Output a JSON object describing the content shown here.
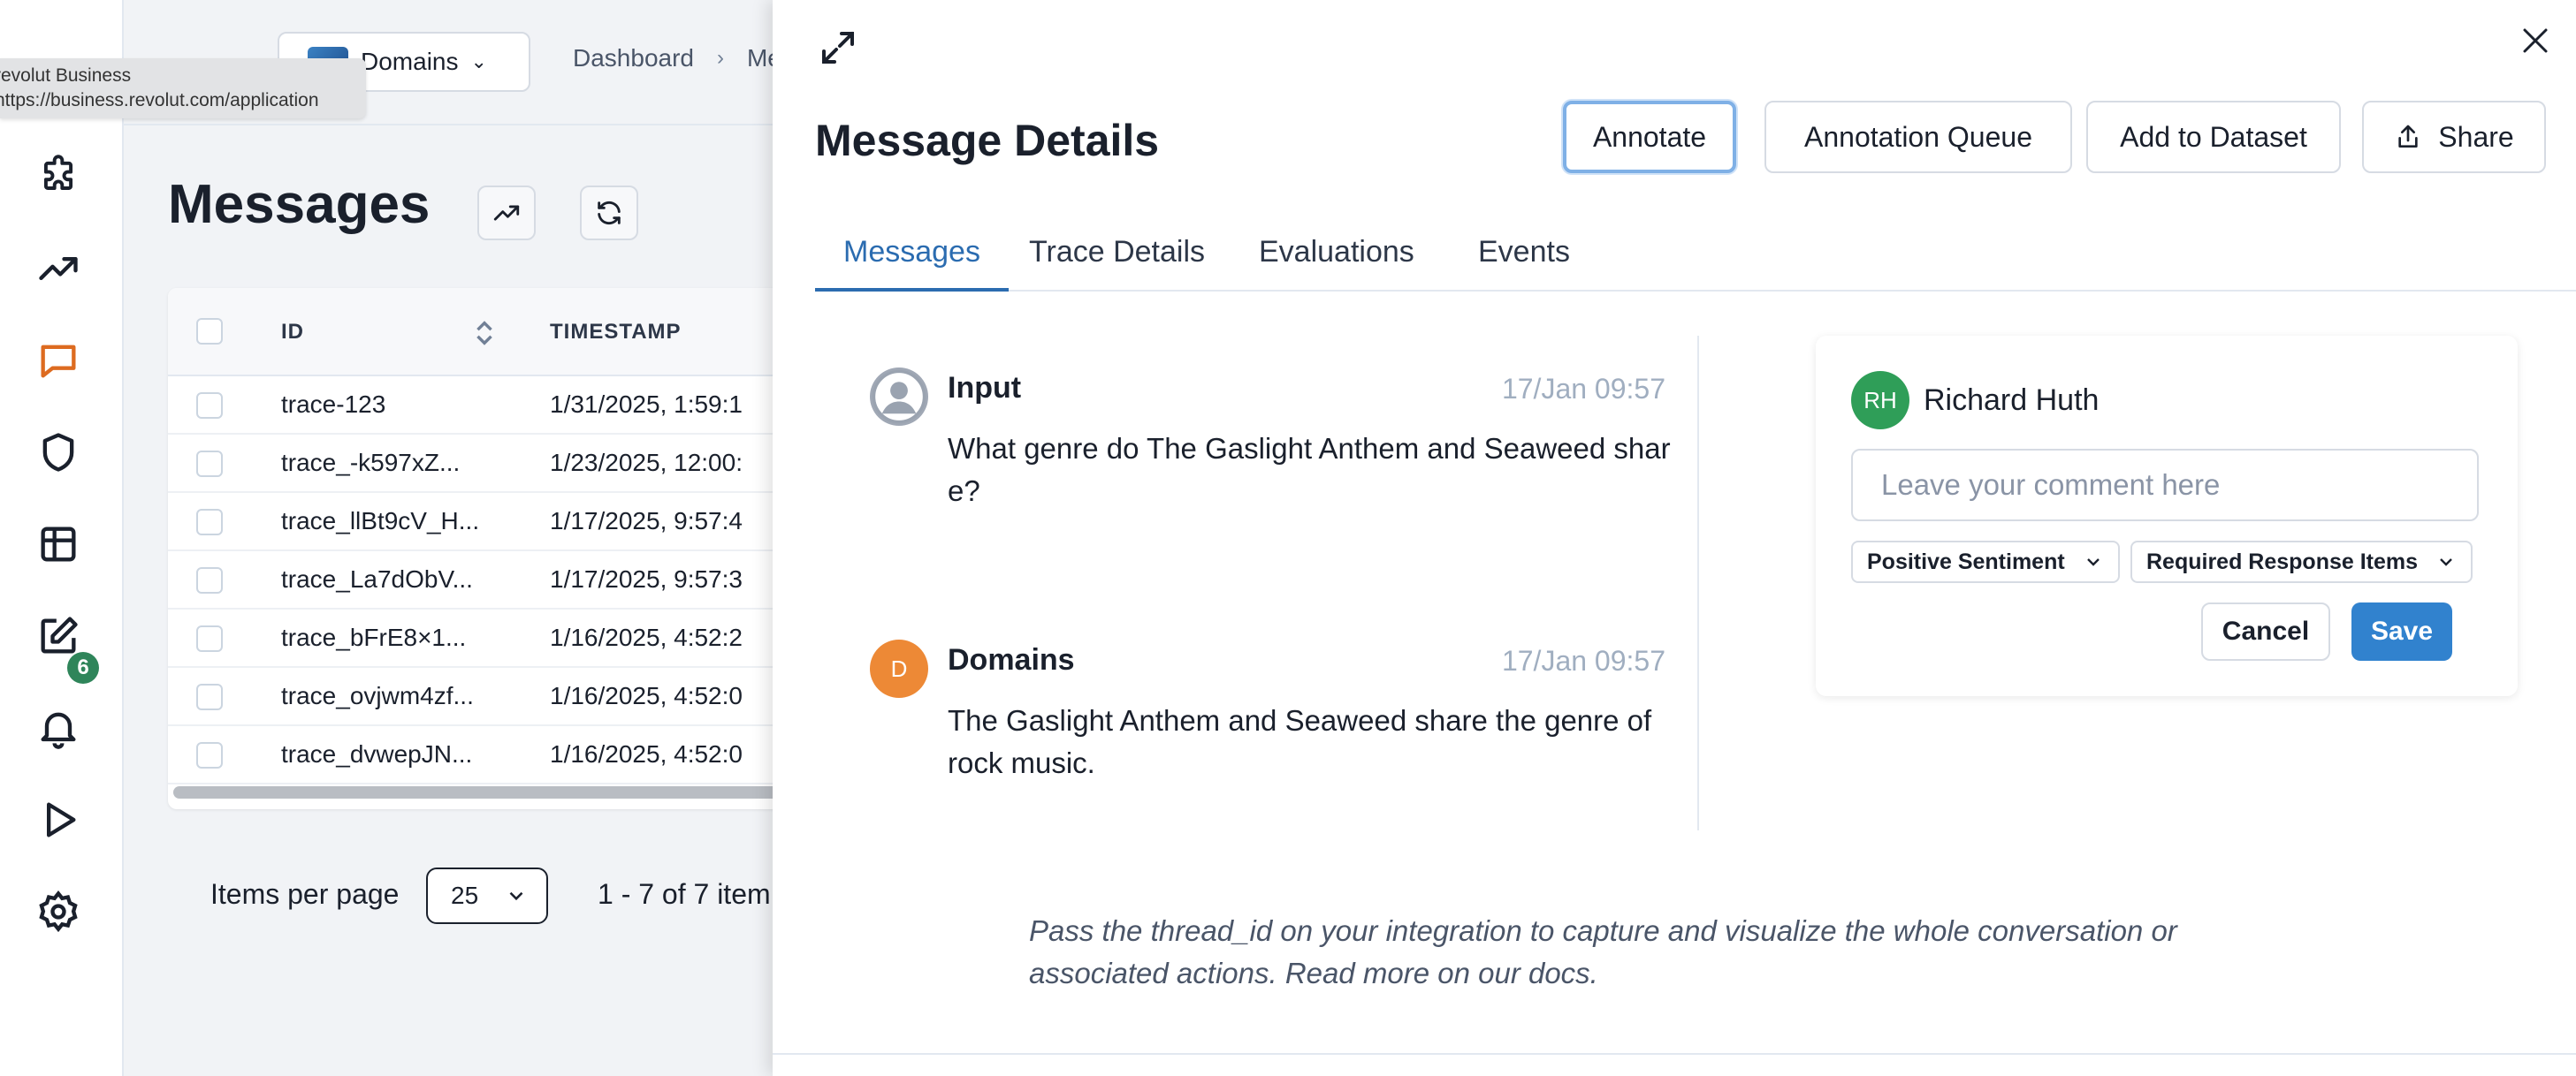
{
  "tooltip": {
    "title": "revolut Business",
    "url": "https://business.revolut.com/application"
  },
  "topbar": {
    "domain_select": "Domains",
    "breadcrumb": [
      "Dashboard",
      "Messages"
    ]
  },
  "rail": {
    "icons": [
      "puzzle-icon",
      "trending-up-icon",
      "chat-icon",
      "shield-icon",
      "table-icon",
      "edit-icon",
      "bell-icon",
      "play-icon",
      "gear-icon"
    ],
    "badge_count": "6",
    "active_color": "#dd6b20"
  },
  "page": {
    "title": "Messages"
  },
  "table": {
    "headers": [
      "ID",
      "TIMESTAMP"
    ],
    "rows": [
      {
        "id": "trace-123",
        "timestamp": "1/31/2025, 1:59:1"
      },
      {
        "id": "trace_-k597xZ...",
        "timestamp": "1/23/2025, 12:00:"
      },
      {
        "id": "trace_llBt9cV_H...",
        "timestamp": "1/17/2025, 9:57:4"
      },
      {
        "id": "trace_La7dObV...",
        "timestamp": "1/17/2025, 9:57:3"
      },
      {
        "id": "trace_bFrE8×1...",
        "timestamp": "1/16/2025, 4:52:2"
      },
      {
        "id": "trace_ovjwm4zf...",
        "timestamp": "1/16/2025, 4:52:0"
      },
      {
        "id": "trace_dvwepJN...",
        "timestamp": "1/16/2025, 4:52:0"
      }
    ]
  },
  "pager": {
    "label": "Items per page",
    "value": "25",
    "count": "1 - 7 of 7 item"
  },
  "drawer": {
    "title": "Message Details",
    "actions": {
      "annotate": "Annotate",
      "queue": "Annotation Queue",
      "dataset": "Add to Dataset",
      "share": "Share"
    },
    "tabs": [
      "Messages",
      "Trace Details",
      "Evaluations",
      "Events"
    ],
    "messages": [
      {
        "name": "Input",
        "time": "17/Jan 09:57",
        "body": "What genre do The Gaslight Anthem and Seaweed share?",
        "avatar": ""
      },
      {
        "name": "Domains",
        "time": "17/Jan 09:57",
        "body": "The Gaslight Anthem and Seaweed share the genre of rock music.",
        "avatar": "D"
      }
    ],
    "comment": {
      "initials": "RH",
      "user": "Richard Huth",
      "placeholder": "Leave your comment here",
      "sentiment": "Positive Sentiment",
      "response": "Required Response Items",
      "cancel": "Cancel",
      "save": "Save"
    },
    "hint": "Pass the thread_id on your integration to capture and visualize the whole conversation or associated actions. Read more on our docs."
  },
  "colors": {
    "accent": "#2b6cb0",
    "save": "#3182ce",
    "domain_avatar": "#ed8936",
    "user_avatar": "#2f9e58"
  }
}
